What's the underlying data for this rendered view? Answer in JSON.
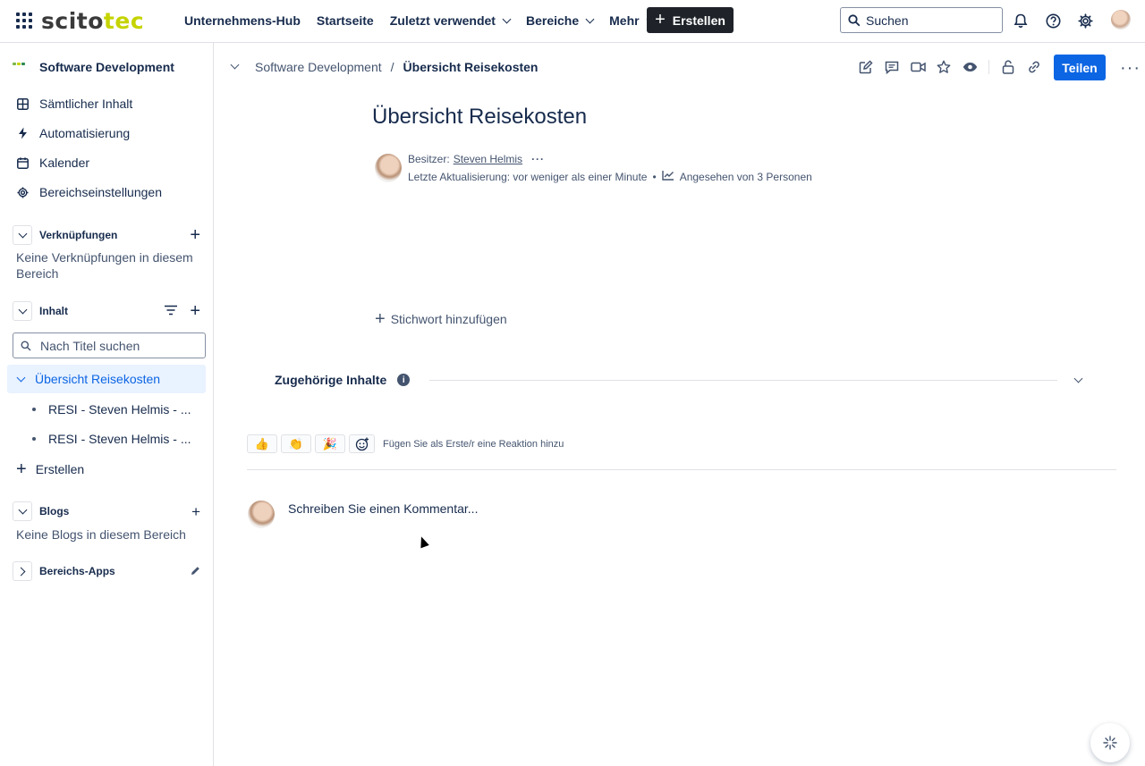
{
  "topbar": {
    "logo_left": "scito",
    "logo_right": "tec",
    "nav": [
      {
        "label": "Unternehmens-Hub",
        "dropdown": false
      },
      {
        "label": "Startseite",
        "dropdown": false
      },
      {
        "label": "Zuletzt verwendet",
        "dropdown": true
      },
      {
        "label": "Bereiche",
        "dropdown": true
      },
      {
        "label": "Mehr",
        "dropdown": true
      }
    ],
    "create_label": "Erstellen",
    "search_placeholder": "Suchen"
  },
  "sidebar": {
    "space_title": "Software Development",
    "links": [
      {
        "label": "Sämtlicher Inhalt",
        "icon": "grid-icon"
      },
      {
        "label": "Automatisierung",
        "icon": "lightning-icon"
      },
      {
        "label": "Kalender",
        "icon": "calendar-icon"
      },
      {
        "label": "Bereichseinstellungen",
        "icon": "gear-icon"
      }
    ],
    "shortcuts": {
      "label": "Verknüpfungen",
      "empty_line1": "Keine Verknüpfungen in diesem",
      "empty_line2": "Bereich"
    },
    "content": {
      "label": "Inhalt",
      "filter_placeholder": "Nach Titel suchen",
      "selected": "Übersicht Reisekosten",
      "children": [
        "RESI - Steven Helmis - ...",
        "RESI - Steven Helmis - ..."
      ],
      "create_label": "Erstellen"
    },
    "blogs": {
      "label": "Blogs",
      "empty": "Keine Blogs in diesem Bereich"
    },
    "apps": {
      "label": "Bereichs-Apps"
    }
  },
  "breadcrumb": {
    "space": "Software Development",
    "separator": "/",
    "current": "Übersicht Reisekosten"
  },
  "page": {
    "share_label": "Teilen",
    "title": "Übersicht Reisekosten",
    "owner_prefix": "Besitzer:",
    "owner_name": "Steven Helmis",
    "last_updated": "Letzte Aktualisierung: vor weniger als einer Minute",
    "bullet": "•",
    "viewed_by": "Angesehen von 3 Personen",
    "add_tag": "Stichwort hinzufügen",
    "related": "Zugehörige Inhalte",
    "reaction_prompt": "Fügen Sie als Erste/r eine Reaktion hinzu",
    "comment_placeholder": "Schreiben Sie einen Kommentar..."
  },
  "colors": {
    "primary": "#0c66e4",
    "selected_bg": "#e9f2ff",
    "create_bg": "#1f2329",
    "text": "#172b4d",
    "muted": "#44546f",
    "logo_accent": "#c5d400"
  }
}
